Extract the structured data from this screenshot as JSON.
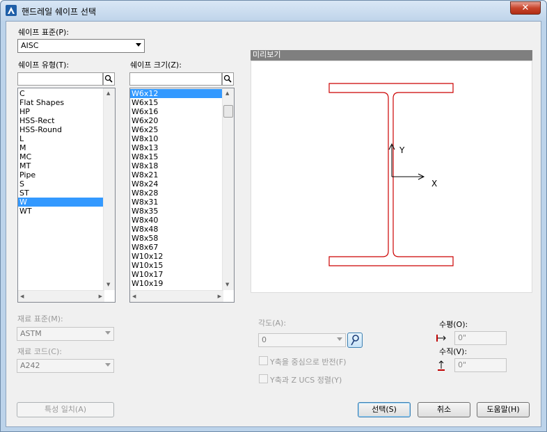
{
  "window": {
    "title": "핸드레일 쉐이프 선택",
    "close_label": "✕"
  },
  "shape_standard": {
    "label": "쉐이프 표준(P):",
    "value": "AISC"
  },
  "shape_type": {
    "label": "쉐이프 유형(T):",
    "search_value": "",
    "items": [
      "C",
      "Flat Shapes",
      "HP",
      "HSS-Rect",
      "HSS-Round",
      "L",
      "M",
      "MC",
      "MT",
      "Pipe",
      "S",
      "ST",
      "W",
      "WT"
    ],
    "selected_index": 12
  },
  "shape_size": {
    "label": "쉐이프 크기(Z):",
    "search_value": "",
    "items": [
      "W6x12",
      "W6x15",
      "W6x16",
      "W6x20",
      "W6x25",
      "W8x10",
      "W8x13",
      "W8x15",
      "W8x18",
      "W8x21",
      "W8x24",
      "W8x28",
      "W8x31",
      "W8x35",
      "W8x40",
      "W8x48",
      "W8x58",
      "W8x67",
      "W10x12",
      "W10x15",
      "W10x17",
      "W10x19"
    ],
    "selected_index": 0
  },
  "preview": {
    "label": "미리보기",
    "axis_y": "Y",
    "axis_x": "X",
    "outline_color": "#cc0000"
  },
  "material_standard": {
    "label": "재료 표준(M):",
    "value": "ASTM"
  },
  "material_code": {
    "label": "재료 코드(C):",
    "value": "A242"
  },
  "angle": {
    "label": "각도(A):",
    "value": "0"
  },
  "flip_y": {
    "label": "Y축을 중심으로 반전(F)"
  },
  "align_ucs": {
    "label": "Y축과 Z UCS 정렬(Y)"
  },
  "horizontal": {
    "label": "수평(O):",
    "value": "0\""
  },
  "vertical": {
    "label": "수직(V):",
    "value": "0\""
  },
  "buttons": {
    "match_props": "특성 일치(A)",
    "select": "선택(S)",
    "cancel": "취소",
    "help": "도움말(H)"
  }
}
